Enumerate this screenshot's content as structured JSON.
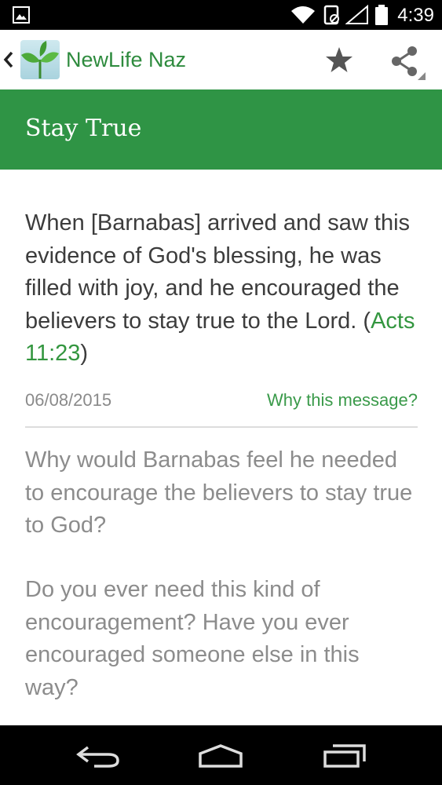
{
  "status_bar": {
    "time": "4:39",
    "icons": [
      "image-icon",
      "wifi-icon",
      "nfc-icon",
      "signal-icon",
      "battery-icon"
    ]
  },
  "action_bar": {
    "app_title": "NewLife Naz",
    "icons": [
      "back-chevron-icon",
      "app-logo-icon",
      "star-icon",
      "share-icon"
    ]
  },
  "header": {
    "title": "Stay True",
    "color": "#2f9445"
  },
  "message": {
    "verse_text": "When [Barnabas] arrived and saw this evidence of God's blessing, he was filled with joy, and he encouraged the believers to stay true to the Lord. (",
    "verse_ref": "Acts 11:23",
    "verse_close": ")",
    "date": "06/08/2015",
    "why_link": "Why this message?",
    "question_1": "Why would Barnabas feel he needed to encourage the believers to stay true to God?",
    "question_2": "Do you ever need this kind of encouragement? Have you ever encouraged someone else in this way?"
  },
  "colors": {
    "accent": "#2f9445",
    "link": "#3a9a4a"
  },
  "nav_bar": {
    "icons": [
      "back-icon",
      "home-icon",
      "recents-icon"
    ]
  }
}
